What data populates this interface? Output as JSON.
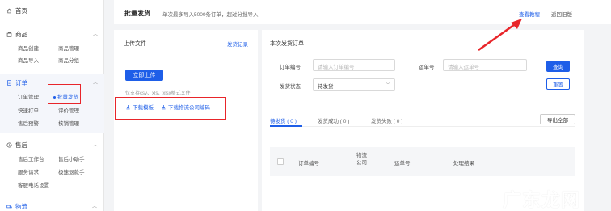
{
  "sidebar": {
    "home": "首页",
    "sections": [
      {
        "label": "商品",
        "items": [
          "商品创建",
          "商品管理",
          "商品导入",
          "商品分组"
        ]
      },
      {
        "label": "订单",
        "items": [
          "订单管理",
          "批量发货",
          "快速打单",
          "评价管理",
          "售后预警",
          "核销管理"
        ]
      },
      {
        "label": "售后",
        "items": [
          "售后工作台",
          "售后小助手",
          "服务请求",
          "极速退款手",
          "客服电话设置"
        ]
      },
      {
        "label": "物流"
      }
    ]
  },
  "topbar": {
    "title": "批量发货",
    "note": "单次最多导入5000条订单，超过分批导入",
    "tutorial": "查看教程",
    "back": "返回旧版"
  },
  "upload": {
    "title": "上传文件",
    "record": "发货记录",
    "button": "立即上传",
    "hint": "仅支持csv、xls、xlsx格式文件",
    "download_template": "下载模板",
    "download_codes": "下载物流公司编码"
  },
  "orders": {
    "title": "本次发货订单",
    "order_no_label": "订单编号",
    "order_no_placeholder": "请输入订单编号",
    "waybill_label": "运单号",
    "waybill_placeholder": "请输入运单号",
    "status_label": "发货状态",
    "status_value": "待发货",
    "query": "查询",
    "reset": "重置",
    "tabs": [
      "待发货 ( 0 )",
      "发货成功 ( 0 )",
      "发货失败 ( 0 )"
    ],
    "export": "导出全部",
    "columns": [
      "订单编号",
      "物流公司",
      "运单号",
      "处理结果"
    ]
  },
  "watermark": "广东龙网",
  "colors": {
    "accent": "#1e5ee8",
    "annotation": "#e8252a"
  }
}
